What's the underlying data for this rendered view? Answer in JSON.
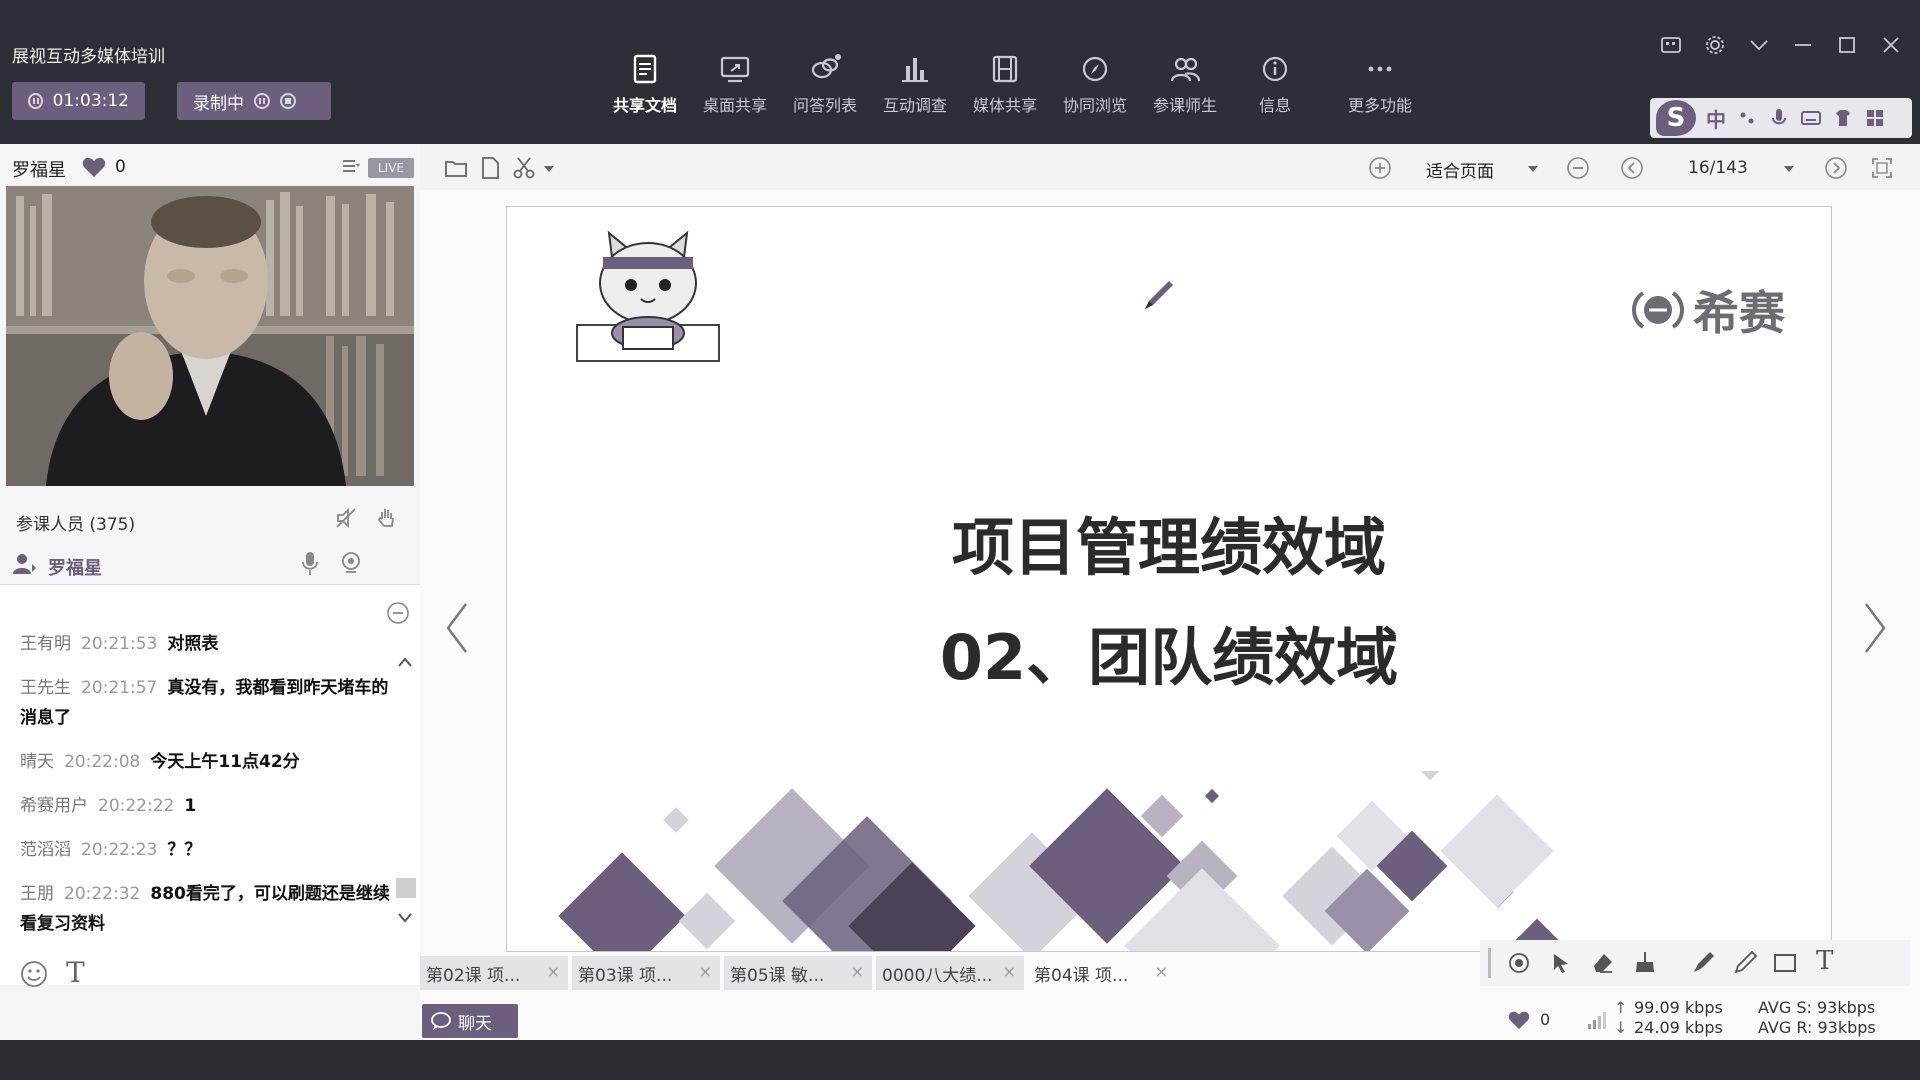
{
  "app": {
    "title": "展视互动多媒体培训"
  },
  "session": {
    "elapsed": "01:03:12",
    "recording_label": "录制中"
  },
  "toolbar": {
    "items": [
      {
        "label": "共享文档",
        "icon": "document-icon"
      },
      {
        "label": "桌面共享",
        "icon": "desktop-share-icon"
      },
      {
        "label": "问答列表",
        "icon": "qa-icon"
      },
      {
        "label": "互动调查",
        "icon": "survey-chart-icon"
      },
      {
        "label": "媒体共享",
        "icon": "media-film-icon"
      },
      {
        "label": "协同浏览",
        "icon": "compass-icon"
      },
      {
        "label": "参课师生",
        "icon": "people-icon"
      },
      {
        "label": "信息",
        "icon": "info-icon"
      },
      {
        "label": "更多功能",
        "icon": "more-icon"
      }
    ]
  },
  "ime": {
    "cn_label": "中"
  },
  "presenter": {
    "name": "罗福星",
    "likes": "0",
    "live_label": "LIVE"
  },
  "participants": {
    "label": "参课人员 (375)",
    "host_name": "罗福星"
  },
  "chat": {
    "messages": [
      {
        "who": "王有明",
        "time": "20:21:53",
        "text": "对照表"
      },
      {
        "who": "王先生",
        "time": "20:21:57",
        "text": "真没有，我都看到昨天堵车的消息了"
      },
      {
        "who": "晴天",
        "time": "20:22:08",
        "text": "今天上午11点42分"
      },
      {
        "who": "希赛用户",
        "time": "20:22:22",
        "text": "1"
      },
      {
        "who": "范滔滔",
        "time": "20:22:23",
        "text": "？？"
      },
      {
        "who": "王朋",
        "time": "20:22:32",
        "text": "880看完了，可以刷题还是继续看复习资料"
      }
    ],
    "button_label": "聊天"
  },
  "document": {
    "fit_mode": "适合页面",
    "page": "16/143",
    "slide": {
      "title": "项目管理绩效域",
      "subtitle": "02、团队绩效域",
      "brand": "希赛"
    },
    "tabs": [
      {
        "label": "第02课 项..."
      },
      {
        "label": "第03课 项..."
      },
      {
        "label": "第05课 敏..."
      },
      {
        "label": "0000八大绩..."
      },
      {
        "label": "第04课 项..."
      }
    ]
  },
  "stats": {
    "likes": "0",
    "upload": "99.09 kbps",
    "download": "24.09 kbps",
    "avg_send": "AVG S: 93kbps",
    "avg_recv": "AVG R: 93kbps"
  },
  "colors": {
    "accent": "#6b5f7d",
    "topbar": "#2e2f36"
  }
}
